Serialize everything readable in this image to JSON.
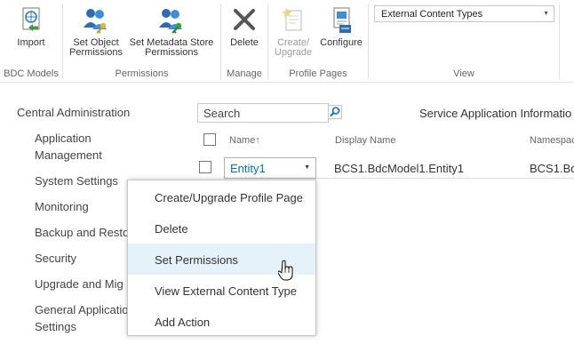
{
  "ribbon": {
    "groups": [
      {
        "label": "BDC Models"
      },
      {
        "label": "Permissions"
      },
      {
        "label": "Manage"
      },
      {
        "label": "Profile Pages"
      },
      {
        "label": "View"
      }
    ],
    "buttons": {
      "import": {
        "line1": "Import",
        "line2": "",
        "icon": "import-icon"
      },
      "set_object_permissions": {
        "line1": "Set Object",
        "line2": "Permissions",
        "icon": "users-key-icon"
      },
      "set_metadata_permissions": {
        "line1": "Set Metadata Store",
        "line2": "Permissions",
        "icon": "users-key-icon"
      },
      "delete": {
        "line1": "Delete",
        "line2": "",
        "icon": "delete-x-icon"
      },
      "create_upgrade": {
        "line1": "Create/",
        "line2": "Upgrade",
        "icon": "page-star-icon"
      },
      "configure": {
        "line1": "Configure",
        "line2": "",
        "icon": "configure-icon"
      }
    },
    "view_select": {
      "value": "External Content Types"
    }
  },
  "nav": {
    "title": "Central Administration",
    "items": [
      {
        "line1": "Application",
        "line2": "Management"
      },
      {
        "line1": "System Settings",
        "line2": ""
      },
      {
        "line1": "Monitoring",
        "line2": ""
      },
      {
        "line1": "Backup and Resto",
        "line2": ""
      },
      {
        "line1": "Security",
        "line2": ""
      },
      {
        "line1": "Upgrade and Mig",
        "line2": ""
      },
      {
        "line1": "General Applicatio",
        "line2": "Settings"
      }
    ]
  },
  "search": {
    "value": "Search"
  },
  "service_app_info": "Service Application Informatio",
  "table": {
    "columns": [
      {
        "label": "Name",
        "sort": "↑"
      },
      {
        "label": "Display Name"
      },
      {
        "label": "Namespac"
      }
    ],
    "rows": [
      {
        "name": "Entity1",
        "display_name": "BCS1.BdcModel1.Entity1",
        "namespace": "BCS1.Bdc"
      }
    ]
  },
  "context_menu": {
    "items": [
      {
        "label": "Create/Upgrade Profile Page"
      },
      {
        "label": "Delete"
      },
      {
        "label": "Set Permissions",
        "hover": true
      },
      {
        "label": "View External Content Type"
      },
      {
        "label": "Add Action"
      }
    ]
  },
  "colors": {
    "link": "#0072c6",
    "menu_hover": "#e6f2fa",
    "border": "#c6c6c6"
  }
}
